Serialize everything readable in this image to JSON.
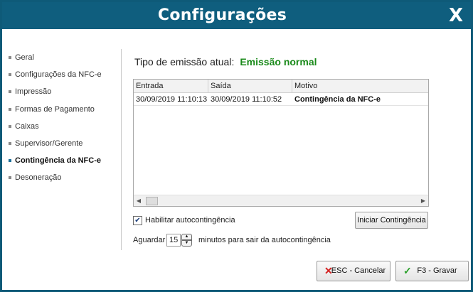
{
  "window": {
    "title": "Configurações",
    "close_label": "X"
  },
  "sidebar": {
    "items": [
      {
        "label": "Geral"
      },
      {
        "label": "Configurações da NFC-e"
      },
      {
        "label": "Impressão"
      },
      {
        "label": "Formas de Pagamento"
      },
      {
        "label": "Caixas"
      },
      {
        "label": "Supervisor/Gerente"
      },
      {
        "label": "Contingência da NFC-e",
        "active": true
      },
      {
        "label": "Desoneração"
      }
    ]
  },
  "main": {
    "emission_label": "Tipo de emissão atual:",
    "emission_value": "Emissão normal",
    "grid": {
      "columns": [
        "Entrada",
        "Saída",
        "Motivo"
      ],
      "rows": [
        {
          "entrada": "30/09/2019 11:10:13",
          "saida": "30/09/2019 11:10:52",
          "motivo": "Contingência da NFC-e"
        }
      ]
    },
    "auto_contingencia": {
      "checked": true,
      "label": "Habilitar autocontingência"
    },
    "iniciar_button": "Iniciar Contingência",
    "await": {
      "prefix": "Aguardar",
      "value": "15",
      "suffix": "minutos para sair da autocontingência"
    }
  },
  "footer": {
    "cancel_label": "ESC - Cancelar",
    "save_label": "F3 - Gravar"
  },
  "colors": {
    "titlebar": "#0f5e7e",
    "emission_value": "#1a8a1a",
    "active_bullet": "#1c6e98"
  }
}
